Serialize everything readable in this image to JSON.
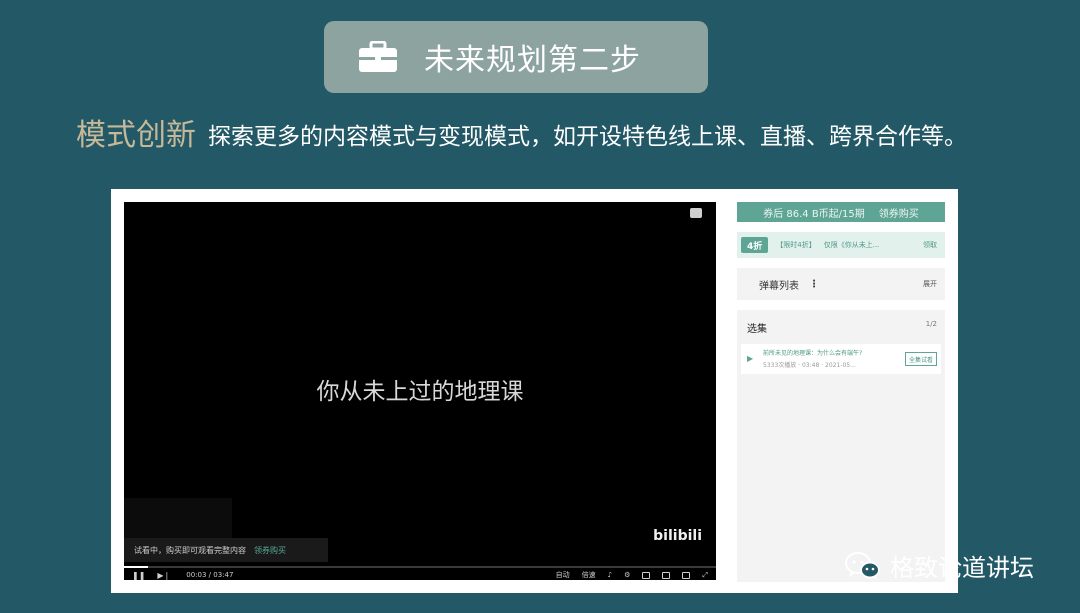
{
  "title": {
    "text": "未来规划第二步",
    "icon": "briefcase-icon"
  },
  "headline": {
    "keyword": "模式创新",
    "description": "探索更多的内容模式与变现模式，如开设特色线上课、直播、跨界合作等。"
  },
  "video": {
    "caption": "你从未上过的地理课",
    "trial_notice": "试看中，购买即可观看完整内容",
    "trial_buy": "领券购买",
    "logo": "bilibili",
    "time": "00:03 / 03:47",
    "progress": 0.016,
    "auto_label": "自动",
    "speed_label": "倍速"
  },
  "sidebar": {
    "price_text": "券后 86.4 B币起/15期",
    "price_buy": "领券购买",
    "coupon_tag": "4折",
    "coupon_limit": "【限时4折】",
    "coupon_desc": "仅限《你从未上...",
    "coupon_claim": "领取",
    "danmaku_label": "弹幕列表",
    "danmaku_expand": "展开",
    "episodes_label": "选集",
    "episodes_count": "1/2",
    "episode": {
      "title": "前所未见的地理课：为什么会有端午?",
      "meta": "5333次播放 · 03:48 · 2021-05...",
      "try_button": "全集试看"
    }
  },
  "watermark": {
    "text": "格致论道讲坛",
    "icon": "wechat-icon"
  },
  "colors": {
    "background": "#235866",
    "title_pill": "#8da39f",
    "keyword": "#c6b99a",
    "accent": "#5fa595"
  }
}
